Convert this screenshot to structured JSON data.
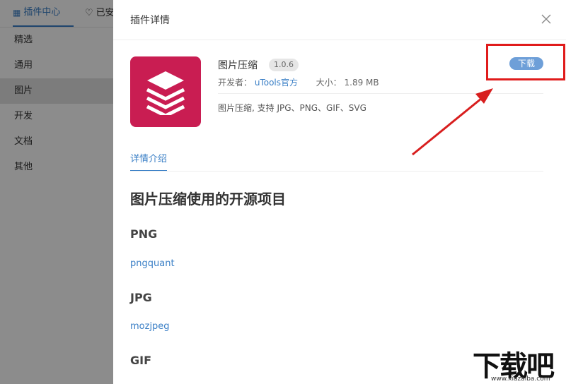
{
  "background": {
    "tabs": [
      {
        "icon": "grid-icon",
        "label": "插件中心"
      },
      {
        "icon": "heart-icon",
        "label": "已安"
      }
    ],
    "sidebar": {
      "items": [
        "精选",
        "通用",
        "图片",
        "开发",
        "文档",
        "其他"
      ],
      "selected_index": 2
    }
  },
  "drawer": {
    "title": "插件详情",
    "plugin": {
      "name": "图片压缩",
      "version": "1.0.6",
      "developer_label": "开发者：",
      "developer": "uTools官方",
      "size_label": "大小：",
      "size": "1.89 MB",
      "description": "图片压缩, 支持 JPG、PNG、GIF、SVG",
      "download_label": "下载"
    },
    "tab": "详情介绍",
    "content": {
      "heading": "图片压缩使用的开源项目",
      "sections": [
        {
          "title": "PNG",
          "link": "pngquant"
        },
        {
          "title": "JPG",
          "link": "mozjpeg"
        },
        {
          "title": "GIF",
          "link": ""
        }
      ]
    }
  },
  "watermark": {
    "text": "下载吧",
    "url": "www.xiazaiba.com"
  },
  "colors": {
    "accent": "#3a7fc6",
    "icon_bg": "#c91d52",
    "highlight": "#e01b1b",
    "download_btn": "#6e9fd8"
  }
}
